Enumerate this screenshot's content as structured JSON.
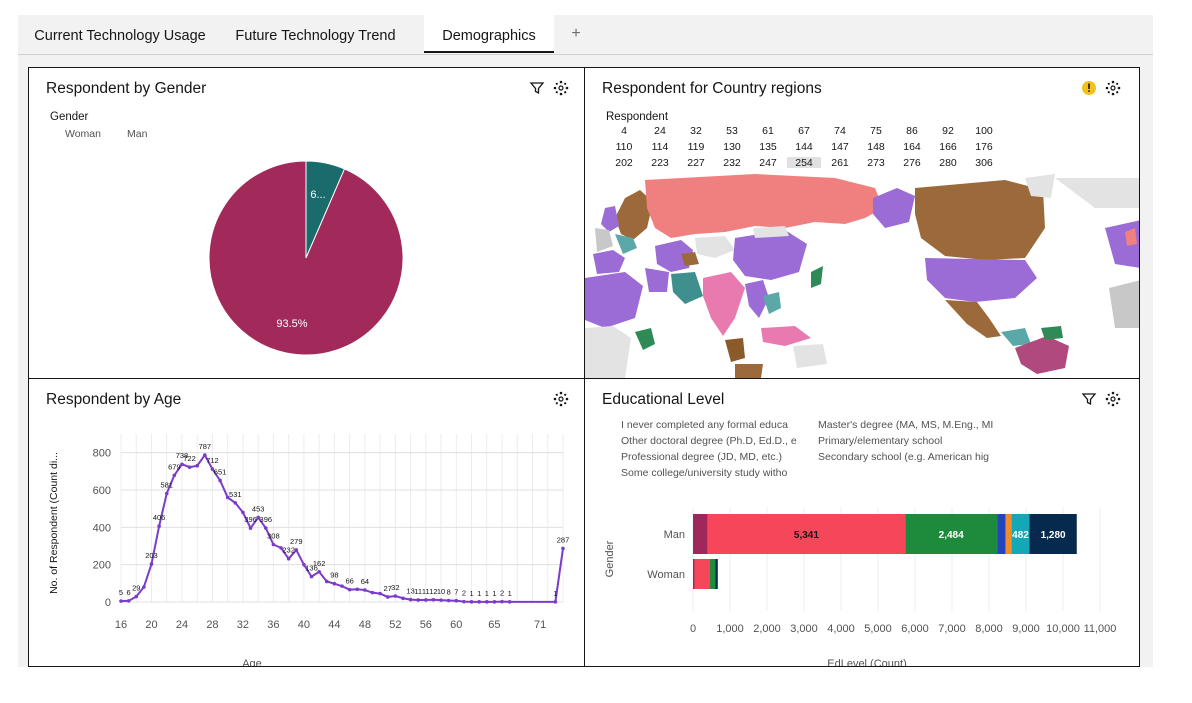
{
  "tabs": [
    {
      "label": "Current Technology Usage",
      "active": false
    },
    {
      "label": "Future Technology Trend",
      "active": false
    },
    {
      "label": "Demographics",
      "active": true
    }
  ],
  "tab_add_label": "+",
  "gender_panel": {
    "title": "Respondent by Gender",
    "legend_title": "Gender",
    "legend_items": [
      "Woman",
      "Man"
    ],
    "slice_labels": [
      "93.5%",
      "6..."
    ]
  },
  "country_panel": {
    "title": "Respondent for Country regions",
    "legend_title": "Respondent",
    "numbers": [
      [
        "4",
        "24",
        "32",
        "53",
        "61",
        "67",
        "74",
        "75",
        "86",
        "92",
        "100"
      ],
      [
        "110",
        "114",
        "119",
        "130",
        "135",
        "144",
        "147",
        "148",
        "164",
        "166",
        "176"
      ],
      [
        "202",
        "223",
        "227",
        "232",
        "247",
        "254",
        "261",
        "273",
        "276",
        "280",
        "306"
      ]
    ],
    "selected_value": "254"
  },
  "age_panel": {
    "title": "Respondent by Age"
  },
  "edu_panel": {
    "title": "Educational Level",
    "legend_items": [
      "I never completed any formal educa",
      "Other doctoral degree (Ph.D, Ed.D., e",
      "Professional degree (JD, MD, etc.)",
      "Some college/university study witho",
      "Master's degree (MA, MS, M.Eng., MI",
      "Primary/elementary school",
      "Secondary school (e.g. American hig"
    ]
  },
  "colors": {
    "man": "#a12a5b",
    "woman": "#1a6b6b",
    "line": "#7b3cc9",
    "edu_dark_pink": "#a0275c",
    "edu_red": "#f6475a",
    "edu_green": "#1e8a3c",
    "edu_blue": "#2443c0",
    "edu_orange": "#f28c28",
    "edu_teal": "#13a8b8",
    "edu_navy": "#052a4d"
  },
  "chart_data": [
    {
      "type": "pie",
      "title": "Respondent by Gender",
      "legend_title": "Gender",
      "categories": [
        "Man",
        "Woman"
      ],
      "values": [
        93.5,
        6.5
      ],
      "data_labels": [
        "93.5%",
        "6..."
      ]
    },
    {
      "type": "line",
      "title": "Respondent by Age",
      "xlabel": "Age",
      "ylabel": "No. of Respondent (Count di...",
      "ylim": [
        0,
        900
      ],
      "xlim": [
        16,
        74
      ],
      "x_ticks": [
        "16",
        "20",
        "24",
        "28",
        "32",
        "36",
        "40",
        "44",
        "48",
        "52",
        "56",
        "60",
        "65",
        "71"
      ],
      "y_ticks": [
        "0",
        "200",
        "400",
        "600",
        "800"
      ],
      "grid": true,
      "points": [
        {
          "x": 16,
          "y": 5,
          "label": "5"
        },
        {
          "x": 17,
          "y": 6,
          "label": "6"
        },
        {
          "x": 18,
          "y": 29,
          "label": "29"
        },
        {
          "x": 19,
          "y": 80,
          "label": ""
        },
        {
          "x": 20,
          "y": 203,
          "label": "203"
        },
        {
          "x": 21,
          "y": 406,
          "label": "406"
        },
        {
          "x": 22,
          "y": 581,
          "label": "581"
        },
        {
          "x": 23,
          "y": 679,
          "label": "679"
        },
        {
          "x": 24,
          "y": 738,
          "label": "738"
        },
        {
          "x": 25,
          "y": 722,
          "label": "722"
        },
        {
          "x": 26,
          "y": 730,
          "label": ""
        },
        {
          "x": 27,
          "y": 787,
          "label": "787"
        },
        {
          "x": 28,
          "y": 712,
          "label": "712"
        },
        {
          "x": 29,
          "y": 651,
          "label": "651"
        },
        {
          "x": 30,
          "y": 560,
          "label": ""
        },
        {
          "x": 31,
          "y": 531,
          "label": "531"
        },
        {
          "x": 32,
          "y": 480,
          "label": ""
        },
        {
          "x": 33,
          "y": 396,
          "label": "396"
        },
        {
          "x": 34,
          "y": 453,
          "label": "453"
        },
        {
          "x": 35,
          "y": 396,
          "label": "396"
        },
        {
          "x": 36,
          "y": 308,
          "label": "308"
        },
        {
          "x": 37,
          "y": 290,
          "label": ""
        },
        {
          "x": 38,
          "y": 232,
          "label": "232"
        },
        {
          "x": 39,
          "y": 279,
          "label": "279"
        },
        {
          "x": 40,
          "y": 200,
          "label": ""
        },
        {
          "x": 41,
          "y": 136,
          "label": "136"
        },
        {
          "x": 42,
          "y": 162,
          "label": "162"
        },
        {
          "x": 43,
          "y": 110,
          "label": ""
        },
        {
          "x": 44,
          "y": 98,
          "label": "98"
        },
        {
          "x": 45,
          "y": 85,
          "label": ""
        },
        {
          "x": 46,
          "y": 66,
          "label": "66"
        },
        {
          "x": 47,
          "y": 68,
          "label": ""
        },
        {
          "x": 48,
          "y": 64,
          "label": "64"
        },
        {
          "x": 49,
          "y": 50,
          "label": ""
        },
        {
          "x": 50,
          "y": 45,
          "label": ""
        },
        {
          "x": 51,
          "y": 27,
          "label": "27"
        },
        {
          "x": 52,
          "y": 32,
          "label": "32"
        },
        {
          "x": 53,
          "y": 20,
          "label": ""
        },
        {
          "x": 54,
          "y": 13,
          "label": "13"
        },
        {
          "x": 55,
          "y": 11,
          "label": "11"
        },
        {
          "x": 56,
          "y": 11,
          "label": "11"
        },
        {
          "x": 57,
          "y": 12,
          "label": "12"
        },
        {
          "x": 58,
          "y": 10,
          "label": "10"
        },
        {
          "x": 59,
          "y": 8,
          "label": "8"
        },
        {
          "x": 60,
          "y": 7,
          "label": "7"
        },
        {
          "x": 61,
          "y": 2,
          "label": "2"
        },
        {
          "x": 62,
          "y": 1,
          "label": "1"
        },
        {
          "x": 63,
          "y": 1,
          "label": "1"
        },
        {
          "x": 64,
          "y": 1,
          "label": "1"
        },
        {
          "x": 65,
          "y": 1,
          "label": "1"
        },
        {
          "x": 66,
          "y": 2,
          "label": "2"
        },
        {
          "x": 67,
          "y": 1,
          "label": "1"
        },
        {
          "x": 73,
          "y": 1,
          "label": "1"
        },
        {
          "x": 74,
          "y": 287,
          "label": "287"
        }
      ]
    },
    {
      "type": "bar",
      "orientation": "horizontal",
      "stacked": true,
      "title": "Educational Level",
      "xlabel": "EdLevel (Count)",
      "ylabel": "Gender",
      "xlim": [
        0,
        11000
      ],
      "x_ticks": [
        "0",
        "1,000",
        "2,000",
        "3,000",
        "4,000",
        "5,000",
        "6,000",
        "7,000",
        "8,000",
        "9,000",
        "10,000",
        "11,000"
      ],
      "categories": [
        "Man",
        "Woman"
      ],
      "series": [
        {
          "color": "#a0275c",
          "values": [
            395,
            40
          ]
        },
        {
          "color": "#f6475a",
          "values": [
            5341,
            420
          ],
          "labels": [
            "5,341",
            ""
          ]
        },
        {
          "color": "#1e8a3c",
          "values": [
            2484,
            140
          ],
          "labels": [
            "2,484",
            ""
          ]
        },
        {
          "color": "#2443c0",
          "values": [
            230,
            0
          ]
        },
        {
          "color": "#f28c28",
          "values": [
            160,
            0
          ]
        },
        {
          "color": "#13a8b8",
          "values": [
            482,
            0
          ],
          "labels": [
            "482",
            ""
          ]
        },
        {
          "color": "#052a4d",
          "values": [
            1280,
            70
          ],
          "labels": [
            "1,280",
            ""
          ]
        }
      ]
    }
  ]
}
